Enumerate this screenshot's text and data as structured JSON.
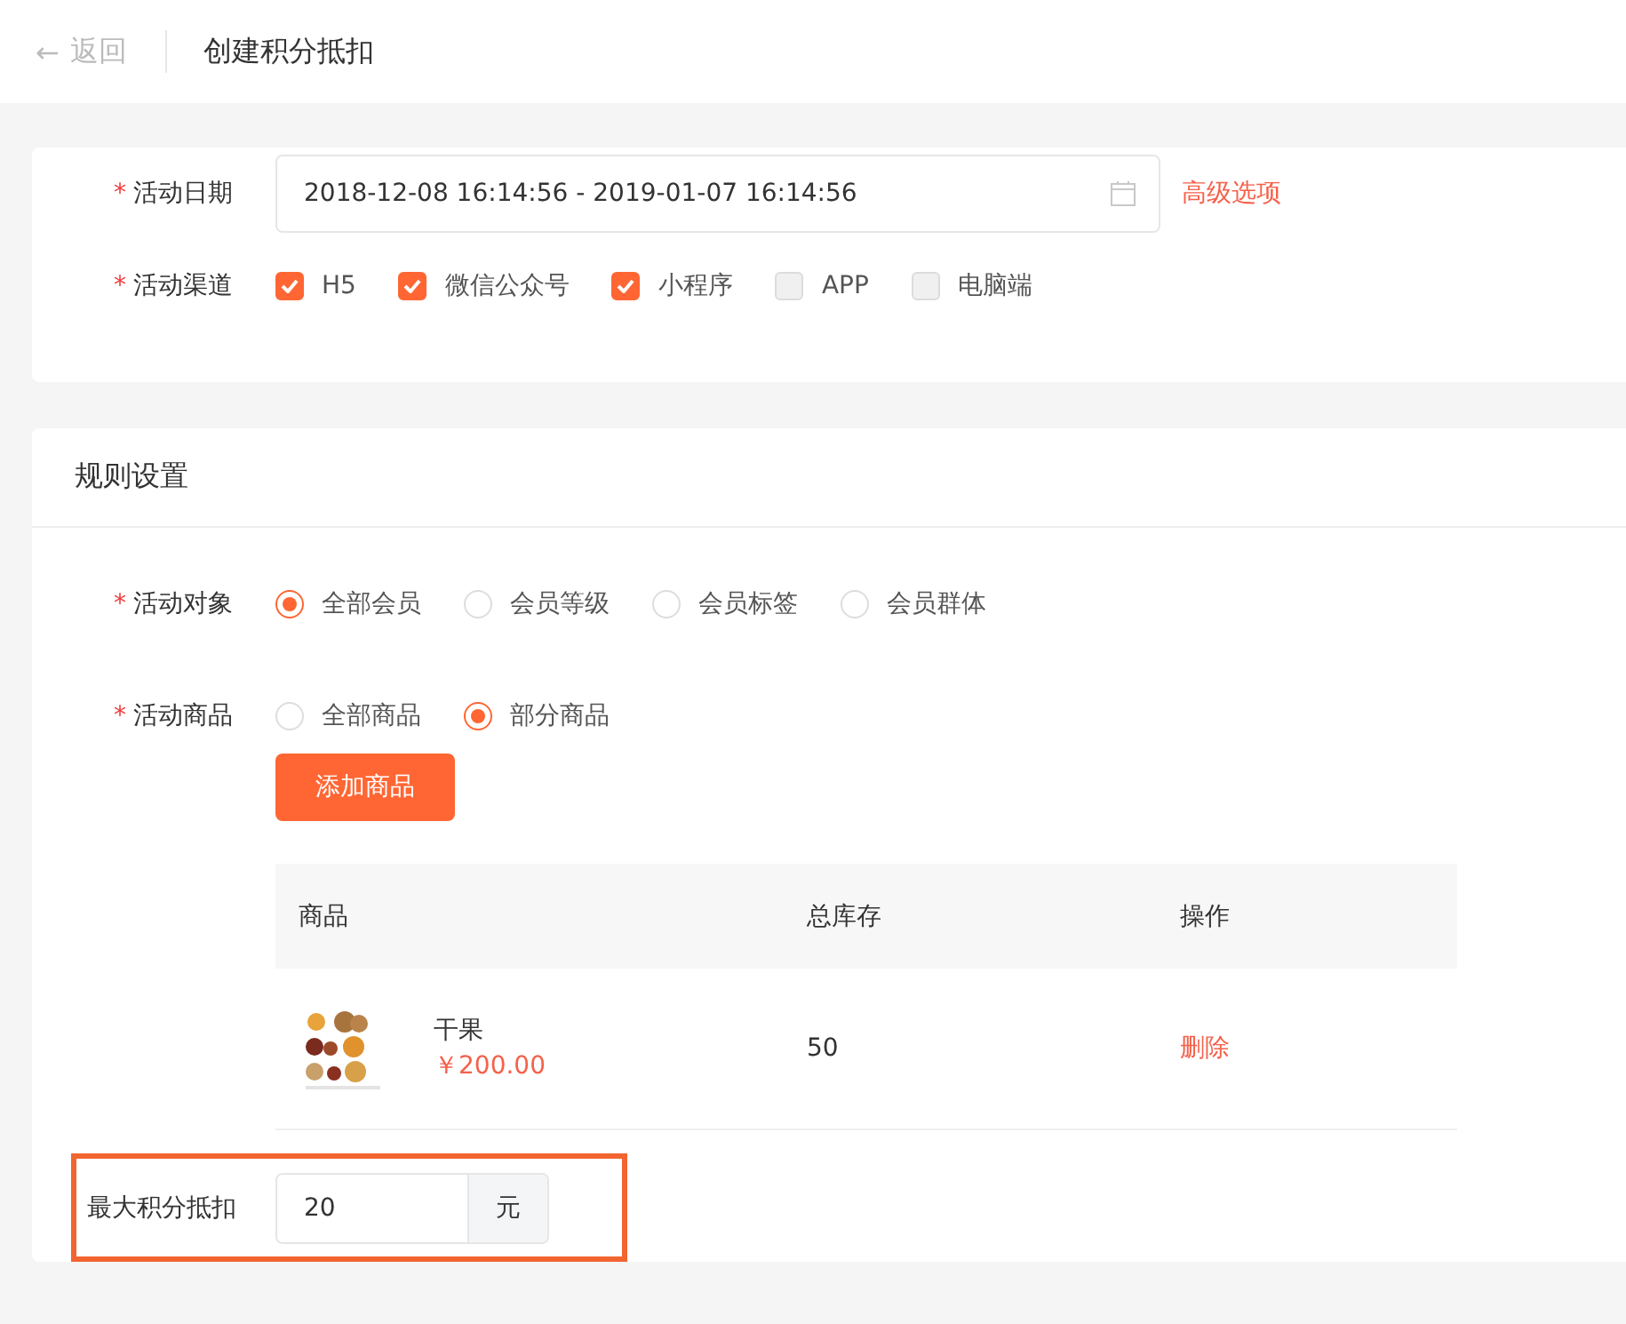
{
  "header": {
    "back_icon": "←",
    "back": "返回",
    "title": "创建积分抵扣"
  },
  "basic": {
    "date": {
      "label": "活动日期",
      "required_mark": "*",
      "value": "2018-12-08 16:14:56 - 2019-01-07 16:14:56",
      "link": "高级选项"
    },
    "channels": {
      "label": "活动渠道",
      "required_mark": "*",
      "options": [
        {
          "label": "H5",
          "checked": true
        },
        {
          "label": "微信公众号",
          "checked": true
        },
        {
          "label": "小程序",
          "checked": true
        },
        {
          "label": "APP",
          "checked": false
        },
        {
          "label": "电脑端",
          "checked": false
        }
      ]
    }
  },
  "rules": {
    "title": "规则设置",
    "target": {
      "label": "活动对象",
      "required_mark": "*",
      "options": [
        {
          "label": "全部会员",
          "selected": true
        },
        {
          "label": "会员等级",
          "selected": false
        },
        {
          "label": "会员标签",
          "selected": false
        },
        {
          "label": "会员群体",
          "selected": false
        }
      ]
    },
    "goods": {
      "label": "活动商品",
      "required_mark": "*",
      "options": [
        {
          "label": "全部商品",
          "selected": false
        },
        {
          "label": "部分商品",
          "selected": true
        }
      ],
      "add_button": "添加商品",
      "table": {
        "columns": [
          "商品",
          "总库存",
          "操作"
        ],
        "rows": [
          {
            "name": "干果",
            "price": "￥200.00",
            "stock": "50",
            "action": "删除"
          }
        ]
      }
    },
    "max": {
      "label": "最大积分抵扣",
      "value": "20",
      "unit": "元",
      "highlighted": true
    }
  }
}
